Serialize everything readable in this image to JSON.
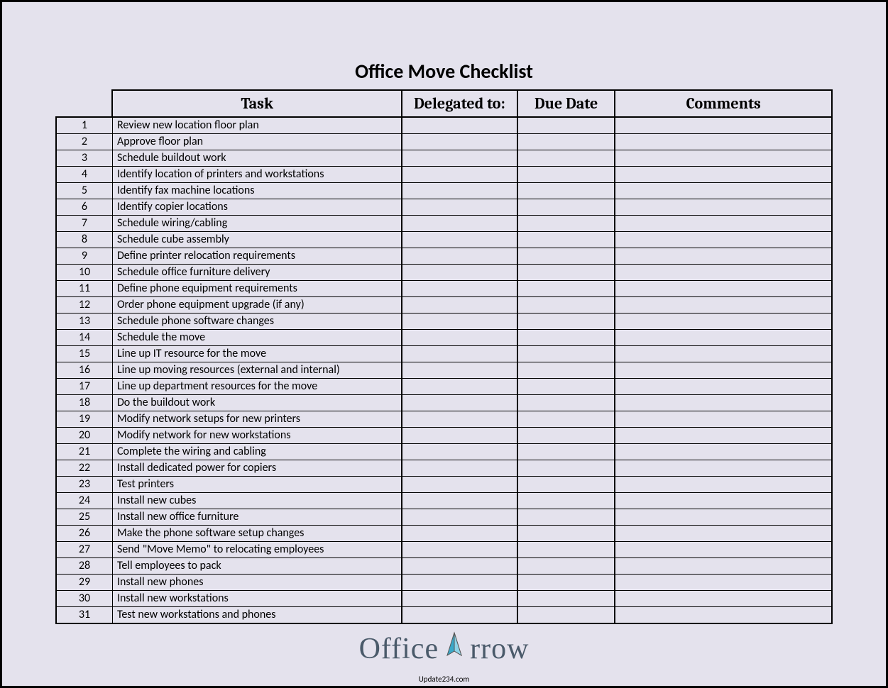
{
  "title": "Office Move Checklist",
  "headers": {
    "num": "",
    "task": "Task",
    "delegated": "Delegated to:",
    "due": "Due Date",
    "comments": "Comments"
  },
  "rows": [
    {
      "num": "1",
      "task": "Review new location floor plan",
      "delegated": "",
      "due": "",
      "comments": ""
    },
    {
      "num": "2",
      "task": "Approve floor plan",
      "delegated": "",
      "due": "",
      "comments": ""
    },
    {
      "num": "3",
      "task": "Schedule buildout work",
      "delegated": "",
      "due": "",
      "comments": ""
    },
    {
      "num": "4",
      "task": "Identify location of printers and workstations",
      "delegated": "",
      "due": "",
      "comments": ""
    },
    {
      "num": "5",
      "task": "Identify fax machine locations",
      "delegated": "",
      "due": "",
      "comments": ""
    },
    {
      "num": "6",
      "task": "Identify copier locations",
      "delegated": "",
      "due": "",
      "comments": ""
    },
    {
      "num": "7",
      "task": "Schedule wiring/cabling",
      "delegated": "",
      "due": "",
      "comments": ""
    },
    {
      "num": "8",
      "task": "Schedule cube assembly",
      "delegated": "",
      "due": "",
      "comments": ""
    },
    {
      "num": "9",
      "task": "Define printer relocation requirements",
      "delegated": "",
      "due": "",
      "comments": ""
    },
    {
      "num": "10",
      "task": "Schedule office furniture delivery",
      "delegated": "",
      "due": "",
      "comments": ""
    },
    {
      "num": "11",
      "task": "Define phone equipment requirements",
      "delegated": "",
      "due": "",
      "comments": ""
    },
    {
      "num": "12",
      "task": "Order phone equipment upgrade (if any)",
      "delegated": "",
      "due": "",
      "comments": ""
    },
    {
      "num": "13",
      "task": "Schedule phone software changes",
      "delegated": "",
      "due": "",
      "comments": ""
    },
    {
      "num": "14",
      "task": "Schedule the move",
      "delegated": "",
      "due": "",
      "comments": ""
    },
    {
      "num": "15",
      "task": "Line up IT resource for the move",
      "delegated": "",
      "due": "",
      "comments": ""
    },
    {
      "num": "16",
      "task": "Line up moving resources (external and internal)",
      "delegated": "",
      "due": "",
      "comments": ""
    },
    {
      "num": "17",
      "task": "Line up department resources for the move",
      "delegated": "",
      "due": "",
      "comments": ""
    },
    {
      "num": "18",
      "task": "Do the buildout work",
      "delegated": "",
      "due": "",
      "comments": ""
    },
    {
      "num": "19",
      "task": "Modify network setups for new printers",
      "delegated": "",
      "due": "",
      "comments": ""
    },
    {
      "num": "20",
      "task": "Modify network for new workstations",
      "delegated": "",
      "due": "",
      "comments": ""
    },
    {
      "num": "21",
      "task": "Complete the wiring and cabling",
      "delegated": "",
      "due": "",
      "comments": ""
    },
    {
      "num": "22",
      "task": "Install dedicated power for copiers",
      "delegated": "",
      "due": "",
      "comments": ""
    },
    {
      "num": "23",
      "task": "Test printers",
      "delegated": "",
      "due": "",
      "comments": ""
    },
    {
      "num": "24",
      "task": "Install new cubes",
      "delegated": "",
      "due": "",
      "comments": ""
    },
    {
      "num": "25",
      "task": "Install new office furniture",
      "delegated": "",
      "due": "",
      "comments": ""
    },
    {
      "num": "26",
      "task": "Make the phone software setup changes",
      "delegated": "",
      "due": "",
      "comments": ""
    },
    {
      "num": "27",
      "task": "Send \"Move Memo\" to relocating employees",
      "delegated": "",
      "due": "",
      "comments": ""
    },
    {
      "num": "28",
      "task": "Tell employees to pack",
      "delegated": "",
      "due": "",
      "comments": ""
    },
    {
      "num": "29",
      "task": "Install new phones",
      "delegated": "",
      "due": "",
      "comments": ""
    },
    {
      "num": "30",
      "task": "Install new workstations",
      "delegated": "",
      "due": "",
      "comments": ""
    },
    {
      "num": "31",
      "task": "Test new workstations and phones",
      "delegated": "",
      "due": "",
      "comments": ""
    }
  ],
  "logo": {
    "part1": "Office",
    "part2": "rrow"
  },
  "footer": "Update234.com"
}
